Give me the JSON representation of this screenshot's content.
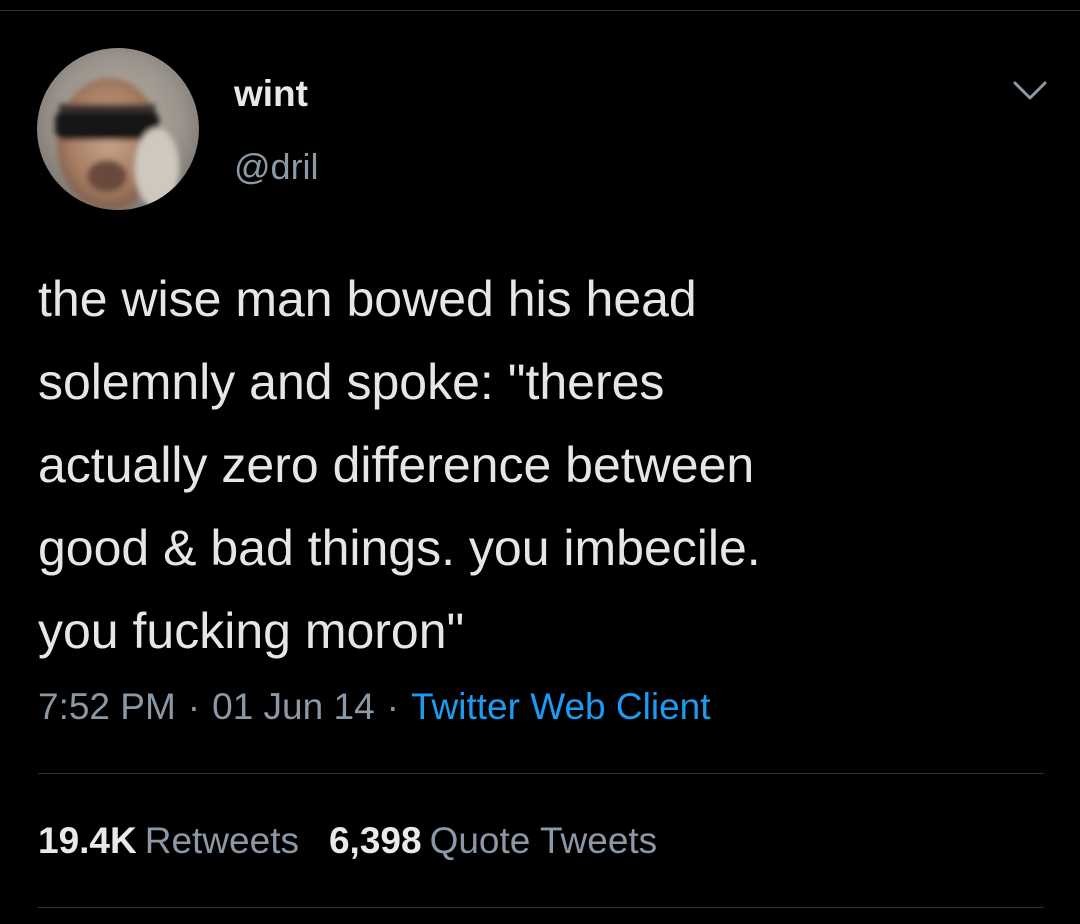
{
  "author": {
    "display_name": "wint",
    "handle": "@dril",
    "avatar_icon": "profile-photo-sunglasses"
  },
  "tweet": {
    "text": "the wise man bowed his head\nsolemnly and spoke: \"theres\nactually zero difference between\ngood & bad things. you imbecile.\nyou fucking moron\""
  },
  "meta": {
    "time": "7:52 PM",
    "separator": "·",
    "date": "01 Jun 14",
    "source": "Twitter Web Client"
  },
  "stats": {
    "retweets_count": "19.4K",
    "retweets_label": "Retweets",
    "quote_count": "6,398",
    "quote_label": "Quote Tweets"
  },
  "icons": {
    "menu": "chevron-down-icon"
  },
  "colors": {
    "background": "#000000",
    "link": "#1d9bf0",
    "secondary_text": "#8b98a5"
  }
}
